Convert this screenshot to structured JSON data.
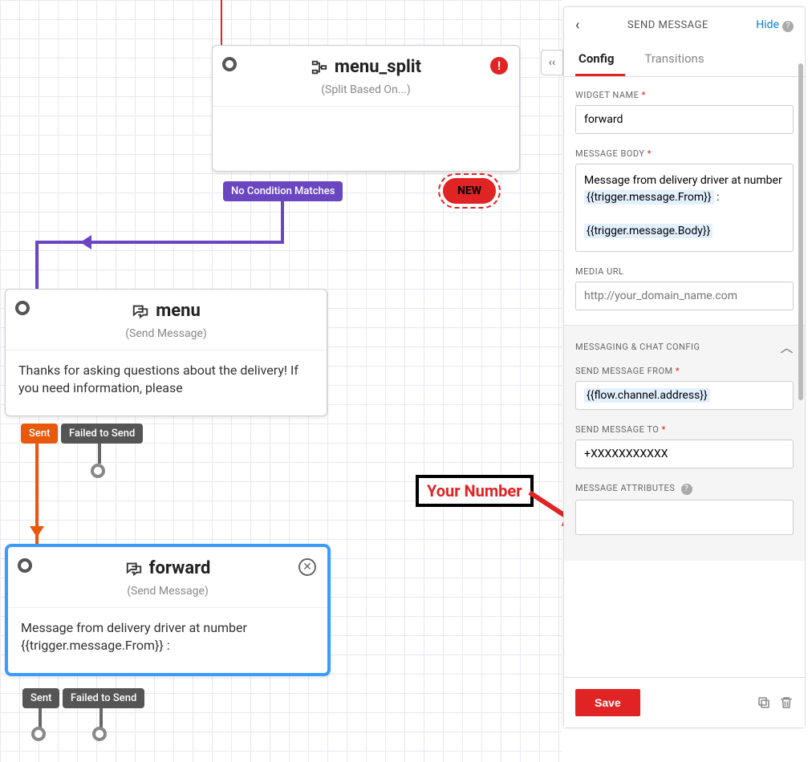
{
  "canvas": {
    "widgets": {
      "menu_split": {
        "title": "menu_split",
        "subtitle": "(Split Based On...)",
        "pills": {
          "no_match": "No Condition Matches",
          "new": "NEW"
        }
      },
      "menu": {
        "title": "menu",
        "subtitle": "(Send Message)",
        "body": "Thanks for asking questions about the delivery! If you need information, please",
        "pills": {
          "sent": "Sent",
          "failed": "Failed to Send"
        }
      },
      "forward": {
        "title": "forward",
        "subtitle": "(Send Message)",
        "body": "Message from delivery driver at number {{trigger.message.From}} :",
        "pills": {
          "sent": "Sent",
          "failed": "Failed to Send"
        }
      }
    },
    "annotation": {
      "label": "Your Number"
    }
  },
  "panel": {
    "title": "SEND MESSAGE",
    "hide_label": "Hide",
    "tabs": {
      "config": "Config",
      "transitions": "Transitions"
    },
    "fields": {
      "widget_name": {
        "label": "WIDGET NAME",
        "value": "forward"
      },
      "message_body": {
        "label": "MESSAGE BODY",
        "text_pre": "Message from delivery driver at number ",
        "chip1": "{{trigger.message.From}}",
        "text_mid": " :",
        "chip2": "{{trigger.message.Body}}"
      },
      "media_url": {
        "label": "MEDIA URL",
        "placeholder": "http://your_domain_name.com"
      },
      "section_title": "MESSAGING & CHAT CONFIG",
      "send_from": {
        "label": "SEND MESSAGE FROM",
        "value": "{{flow.channel.address}}"
      },
      "send_to": {
        "label": "SEND MESSAGE TO",
        "value": "+XXXXXXXXXXX"
      },
      "attributes": {
        "label": "MESSAGE ATTRIBUTES",
        "value": ""
      }
    },
    "save_label": "Save"
  }
}
